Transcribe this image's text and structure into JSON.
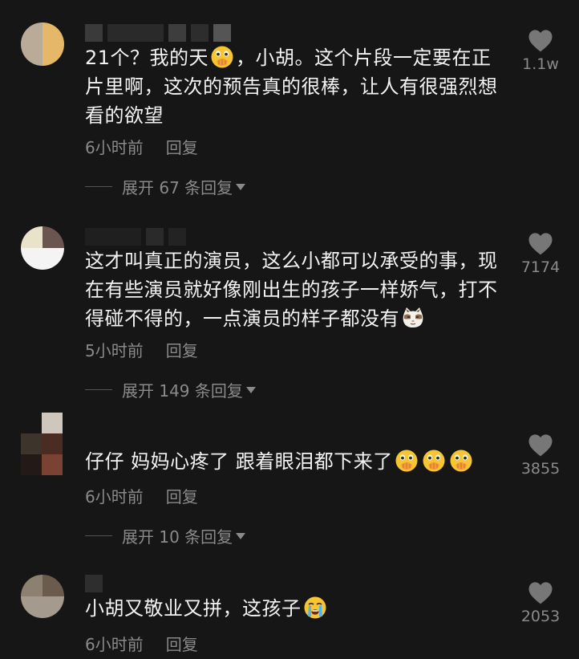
{
  "comments": [
    {
      "text_main": "21个？我的天",
      "text_emoji": "hand-over-mouth",
      "text_rest": "，小胡。这个片段一定要在正片里啊，这次的预告真的很棒，让人有很强烈想看的欲望",
      "time": "6小时前",
      "reply_label": "回复",
      "expand_label": "展开 67 条回复",
      "like_count": "1.1w"
    },
    {
      "text_main": "这才叫真正的演员，这么小都可以承受的事，现在有些演员就好像刚出生的孩子一样娇气，打不得碰不得的，一点演员的样子都没有",
      "text_emoji": "cat-face",
      "time": "5小时前",
      "reply_label": "回复",
      "expand_label": "展开 149 条回复",
      "like_count": "7174"
    },
    {
      "text_main": "仔仔 妈妈心疼了 跟着眼泪都下来了",
      "text_emoji": "hand-over-mouth x3",
      "time": "6小时前",
      "reply_label": "回复",
      "expand_label": "展开 10 条回复",
      "like_count": "3855"
    },
    {
      "text_main": "小胡又敬业又拼，这孩子",
      "text_emoji": "crying-face",
      "time": "6小时前",
      "reply_label": "回复",
      "like_count": "2053"
    }
  ]
}
